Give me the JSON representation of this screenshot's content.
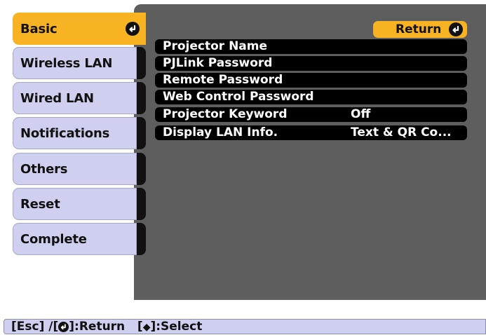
{
  "sidebar": {
    "items": [
      {
        "label": "Basic",
        "active": true
      },
      {
        "label": "Wireless LAN",
        "active": false
      },
      {
        "label": "Wired LAN",
        "active": false
      },
      {
        "label": "Notifications",
        "active": false
      },
      {
        "label": "Others",
        "active": false
      },
      {
        "label": "Reset",
        "active": false
      },
      {
        "label": "Complete",
        "active": false
      }
    ]
  },
  "panel": {
    "return_label": "Return",
    "rows": [
      {
        "label": "Projector Name",
        "value": ""
      },
      {
        "label": "PJLink Password",
        "value": ""
      },
      {
        "label": "Remote Password",
        "value": ""
      },
      {
        "label": "Web Control Password",
        "value": ""
      },
      {
        "label": "Projector Keyword",
        "value": "Off"
      },
      {
        "label": "Display LAN Info.",
        "value": "Text & QR Co..."
      }
    ]
  },
  "help": {
    "part1": "[Esc] /[",
    "part2": "]:Return   [",
    "part3": "]:Select"
  },
  "colors": {
    "accent": "#f7b321",
    "tab_bg": "#cfcfef",
    "panel_bg": "#5e5e5e",
    "row_bg": "#000000"
  },
  "icons": {
    "enter": "enter-icon",
    "updown": "up-down-arrow-icon"
  }
}
